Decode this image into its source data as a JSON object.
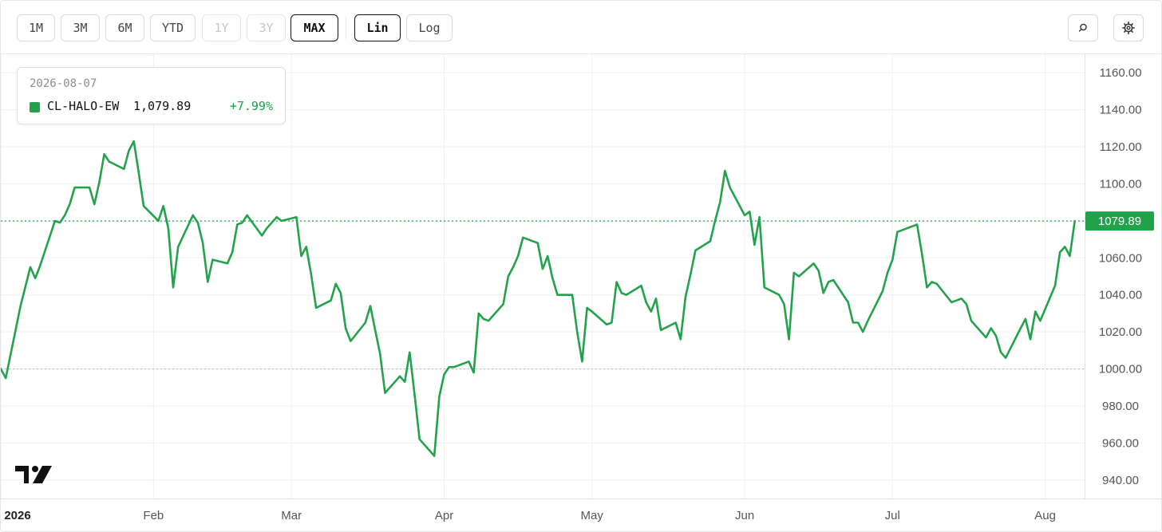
{
  "toolbar": {
    "range_buttons": [
      {
        "label": "1M",
        "state": "normal"
      },
      {
        "label": "3M",
        "state": "normal"
      },
      {
        "label": "6M",
        "state": "normal"
      },
      {
        "label": "YTD",
        "state": "normal"
      },
      {
        "label": "1Y",
        "state": "disabled"
      },
      {
        "label": "3Y",
        "state": "disabled"
      },
      {
        "label": "MAX",
        "state": "active"
      }
    ],
    "scale_buttons": [
      {
        "label": "Lin",
        "state": "active"
      },
      {
        "label": "Log",
        "state": "normal"
      }
    ],
    "search_icon": "search-icon",
    "settings_icon": "gear-icon"
  },
  "legend": {
    "date": "2026-08-07",
    "series_name": "CL-HALO-EW",
    "value": "1,079.89",
    "change": "+7.99%",
    "change_color": "#16a34a"
  },
  "colors": {
    "series": "#22a24a",
    "baseline": "#bdbdbd",
    "grid": "#eef0f2"
  },
  "logo_icon": "tradingview-logo-icon",
  "chart_data": {
    "type": "line",
    "title": "",
    "xlabel": "",
    "ylabel": "",
    "ylim": [
      930,
      1170
    ],
    "yticks": [
      940,
      960,
      980,
      1000,
      1020,
      1040,
      1060,
      1080,
      1100,
      1120,
      1140,
      1160
    ],
    "ytick_labels": [
      "940.00",
      "960.00",
      "980.00",
      "1000.00",
      "1020.00",
      "1040.00",
      "1060.00",
      "1080.00",
      "1100.00",
      "1120.00",
      "1140.00",
      "1160.00"
    ],
    "xlim": [
      "2026-01-01",
      "2026-08-09"
    ],
    "xticks": [
      {
        "date": "2026-01-01",
        "label": "2026",
        "bold": true
      },
      {
        "date": "2026-02-01",
        "label": "Feb",
        "bold": false
      },
      {
        "date": "2026-03-01",
        "label": "Mar",
        "bold": false
      },
      {
        "date": "2026-04-01",
        "label": "Apr",
        "bold": false
      },
      {
        "date": "2026-05-01",
        "label": "May",
        "bold": false
      },
      {
        "date": "2026-06-01",
        "label": "Jun",
        "bold": false
      },
      {
        "date": "2026-07-01",
        "label": "Jul",
        "bold": false
      },
      {
        "date": "2026-08-01",
        "label": "Aug",
        "bold": false
      }
    ],
    "baseline": 1000,
    "last_value": 1079.89,
    "last_value_label": "1079.89",
    "grid": true,
    "legend": "top-left",
    "series": [
      {
        "color": "#22a24a",
        "points": [
          [
            "2026-01-01",
            1000
          ],
          [
            "2026-01-02",
            995
          ],
          [
            "2026-01-05",
            1034
          ],
          [
            "2026-01-07",
            1055
          ],
          [
            "2026-01-08",
            1049
          ],
          [
            "2026-01-09",
            1056
          ],
          [
            "2026-01-12",
            1080
          ],
          [
            "2026-01-13",
            1079
          ],
          [
            "2026-01-14",
            1083
          ],
          [
            "2026-01-15",
            1089
          ],
          [
            "2026-01-16",
            1098
          ],
          [
            "2026-01-19",
            1098
          ],
          [
            "2026-01-20",
            1089
          ],
          [
            "2026-01-21",
            1101
          ],
          [
            "2026-01-22",
            1116
          ],
          [
            "2026-01-23",
            1112
          ],
          [
            "2026-01-26",
            1108
          ],
          [
            "2026-01-27",
            1118
          ],
          [
            "2026-01-28",
            1123
          ],
          [
            "2026-01-29",
            1106
          ],
          [
            "2026-01-30",
            1088
          ],
          [
            "2026-02-02",
            1080
          ],
          [
            "2026-02-03",
            1088
          ],
          [
            "2026-02-04",
            1076
          ],
          [
            "2026-02-05",
            1044
          ],
          [
            "2026-02-06",
            1066
          ],
          [
            "2026-02-09",
            1083
          ],
          [
            "2026-02-10",
            1079
          ],
          [
            "2026-02-11",
            1068
          ],
          [
            "2026-02-12",
            1047
          ],
          [
            "2026-02-13",
            1059
          ],
          [
            "2026-02-16",
            1057
          ],
          [
            "2026-02-17",
            1063
          ],
          [
            "2026-02-18",
            1078
          ],
          [
            "2026-02-19",
            1079
          ],
          [
            "2026-02-20",
            1083
          ],
          [
            "2026-02-23",
            1072
          ],
          [
            "2026-02-24",
            1076
          ],
          [
            "2026-02-25",
            1079
          ],
          [
            "2026-02-26",
            1082
          ],
          [
            "2026-02-27",
            1080
          ],
          [
            "2026-03-02",
            1082
          ],
          [
            "2026-03-03",
            1061
          ],
          [
            "2026-03-04",
            1066
          ],
          [
            "2026-03-05",
            1051
          ],
          [
            "2026-03-06",
            1033
          ],
          [
            "2026-03-09",
            1037
          ],
          [
            "2026-03-10",
            1046
          ],
          [
            "2026-03-11",
            1041
          ],
          [
            "2026-03-12",
            1022
          ],
          [
            "2026-03-13",
            1015
          ],
          [
            "2026-03-16",
            1025
          ],
          [
            "2026-03-17",
            1034
          ],
          [
            "2026-03-18",
            1021
          ],
          [
            "2026-03-19",
            1008
          ],
          [
            "2026-03-20",
            987
          ],
          [
            "2026-03-23",
            996
          ],
          [
            "2026-03-24",
            993
          ],
          [
            "2026-03-25",
            1009
          ],
          [
            "2026-03-26",
            986
          ],
          [
            "2026-03-27",
            962
          ],
          [
            "2026-03-30",
            953
          ],
          [
            "2026-03-31",
            985
          ],
          [
            "2026-04-01",
            997
          ],
          [
            "2026-04-02",
            1001
          ],
          [
            "2026-04-03",
            1001
          ],
          [
            "2026-04-06",
            1004
          ],
          [
            "2026-04-07",
            998
          ],
          [
            "2026-04-08",
            1030
          ],
          [
            "2026-04-09",
            1027
          ],
          [
            "2026-04-10",
            1026
          ],
          [
            "2026-04-13",
            1035
          ],
          [
            "2026-04-14",
            1050
          ],
          [
            "2026-04-15",
            1055
          ],
          [
            "2026-04-16",
            1061
          ],
          [
            "2026-04-17",
            1071
          ],
          [
            "2026-04-20",
            1068
          ],
          [
            "2026-04-21",
            1054
          ],
          [
            "2026-04-22",
            1061
          ],
          [
            "2026-04-23",
            1049
          ],
          [
            "2026-04-24",
            1040
          ],
          [
            "2026-04-27",
            1040
          ],
          [
            "2026-04-28",
            1020
          ],
          [
            "2026-04-29",
            1004
          ],
          [
            "2026-04-30",
            1033
          ],
          [
            "2026-05-01",
            1031
          ],
          [
            "2026-05-04",
            1024
          ],
          [
            "2026-05-05",
            1025
          ],
          [
            "2026-05-06",
            1047
          ],
          [
            "2026-05-07",
            1041
          ],
          [
            "2026-05-08",
            1040
          ],
          [
            "2026-05-11",
            1045
          ],
          [
            "2026-05-12",
            1036
          ],
          [
            "2026-05-13",
            1031
          ],
          [
            "2026-05-14",
            1038
          ],
          [
            "2026-05-15",
            1021
          ],
          [
            "2026-05-18",
            1025
          ],
          [
            "2026-05-19",
            1016
          ],
          [
            "2026-05-20",
            1039
          ],
          [
            "2026-05-21",
            1051
          ],
          [
            "2026-05-22",
            1064
          ],
          [
            "2026-05-25",
            1069
          ],
          [
            "2026-05-26",
            1080
          ],
          [
            "2026-05-27",
            1090
          ],
          [
            "2026-05-28",
            1107
          ],
          [
            "2026-05-29",
            1098
          ],
          [
            "2026-06-01",
            1083
          ],
          [
            "2026-06-02",
            1085
          ],
          [
            "2026-06-03",
            1067
          ],
          [
            "2026-06-04",
            1082
          ],
          [
            "2026-06-05",
            1044
          ],
          [
            "2026-06-08",
            1040
          ],
          [
            "2026-06-09",
            1035
          ],
          [
            "2026-06-10",
            1016
          ],
          [
            "2026-06-11",
            1052
          ],
          [
            "2026-06-12",
            1050
          ],
          [
            "2026-06-15",
            1057
          ],
          [
            "2026-06-16",
            1053
          ],
          [
            "2026-06-17",
            1041
          ],
          [
            "2026-06-18",
            1047
          ],
          [
            "2026-06-19",
            1048
          ],
          [
            "2026-06-22",
            1036
          ],
          [
            "2026-06-23",
            1025
          ],
          [
            "2026-06-24",
            1025
          ],
          [
            "2026-06-25",
            1020
          ],
          [
            "2026-06-26",
            1026
          ],
          [
            "2026-06-29",
            1042
          ],
          [
            "2026-06-30",
            1052
          ],
          [
            "2026-07-01",
            1059
          ],
          [
            "2026-07-02",
            1074
          ],
          [
            "2026-07-06",
            1078
          ],
          [
            "2026-07-07",
            1062
          ],
          [
            "2026-07-08",
            1044
          ],
          [
            "2026-07-09",
            1047
          ],
          [
            "2026-07-10",
            1046
          ],
          [
            "2026-07-13",
            1036
          ],
          [
            "2026-07-14",
            1037
          ],
          [
            "2026-07-15",
            1038
          ],
          [
            "2026-07-16",
            1035
          ],
          [
            "2026-07-17",
            1026
          ],
          [
            "2026-07-20",
            1017
          ],
          [
            "2026-07-21",
            1022
          ],
          [
            "2026-07-22",
            1018
          ],
          [
            "2026-07-23",
            1009
          ],
          [
            "2026-07-24",
            1006
          ],
          [
            "2026-07-27",
            1022
          ],
          [
            "2026-07-28",
            1027
          ],
          [
            "2026-07-29",
            1016
          ],
          [
            "2026-07-30",
            1031
          ],
          [
            "2026-07-31",
            1026
          ],
          [
            "2026-08-03",
            1045
          ],
          [
            "2026-08-04",
            1063
          ],
          [
            "2026-08-05",
            1066
          ],
          [
            "2026-08-06",
            1061
          ],
          [
            "2026-08-07",
            1079.89
          ]
        ]
      }
    ]
  }
}
